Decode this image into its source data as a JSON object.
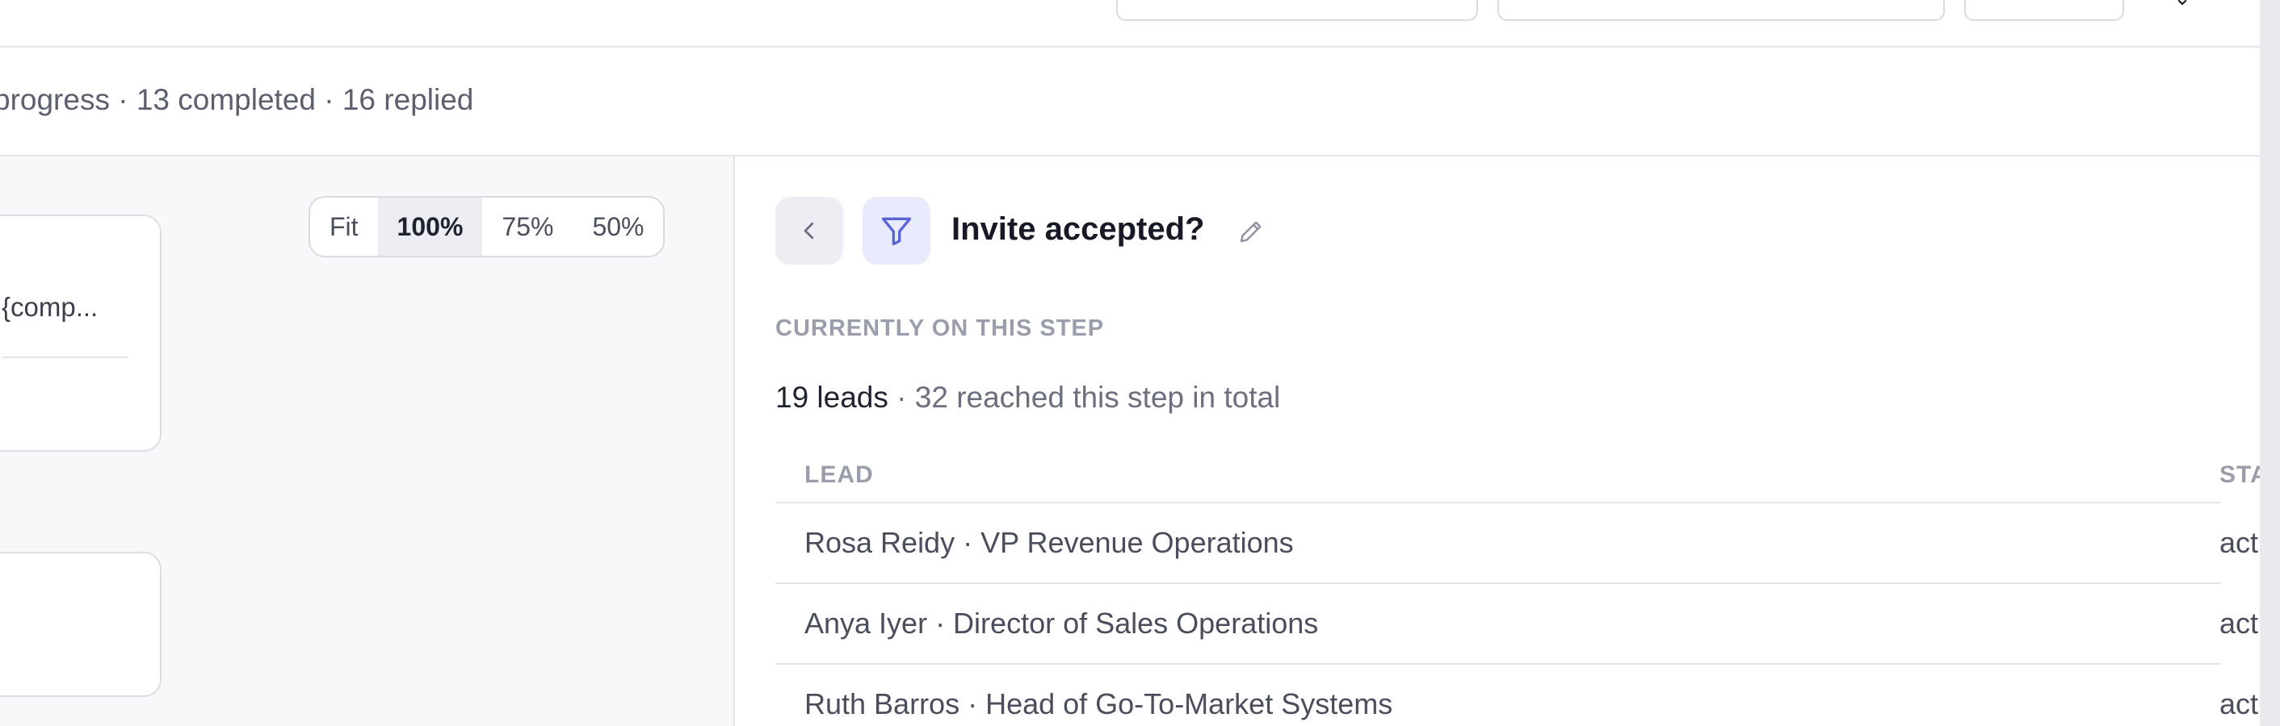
{
  "header": {
    "buttons": [
      {
        "label": ""
      },
      {
        "label": ""
      },
      {
        "label": ""
      }
    ],
    "more_label": "⌄"
  },
  "summary": {
    "text": "progress · 13 completed · 16 replied"
  },
  "canvas": {
    "node_text": "{comp...",
    "zoom_options": [
      "Fit",
      "100%",
      "75%",
      "50%"
    ],
    "zoom_selected": "100%"
  },
  "panel": {
    "title": "Invite accepted?",
    "section_label": "CURRENTLY ON THIS STEP",
    "leads_count": "19 leads",
    "leads_total": " · 32 reached this step in total",
    "table": {
      "columns": [
        "LEAD",
        "STA"
      ],
      "rows": [
        {
          "lead": "Rosa Reidy · VP Revenue Operations",
          "status": "act"
        },
        {
          "lead": "Anya Iyer · Director of Sales Operations",
          "status": "act"
        },
        {
          "lead": "Ruth Barros · Head of Go-To-Market Systems",
          "status": "act"
        }
      ]
    }
  },
  "colors": {
    "accent": "#5b63d9",
    "accent_bg": "#e8ebfb",
    "border": "#e3e5ea",
    "muted_text": "#9a9dab"
  },
  "icons": {
    "back": "chevron-left-icon",
    "filter": "filter-icon",
    "edit": "pencil-icon"
  }
}
